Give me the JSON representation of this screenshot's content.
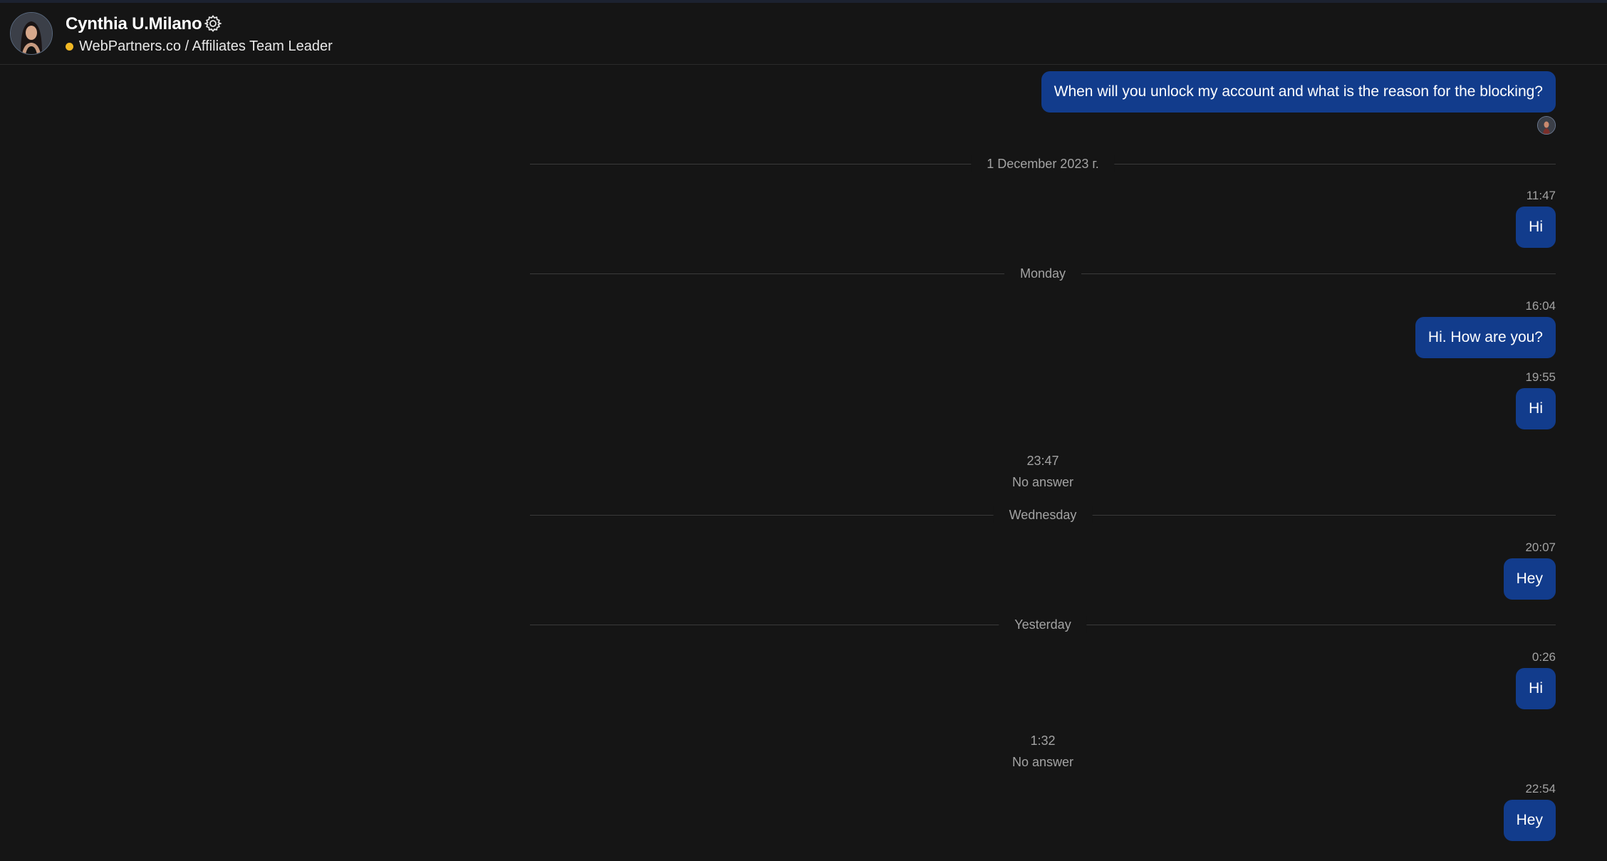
{
  "header": {
    "name": "Cynthia U.Milano",
    "subtitle": "WebPartners.co / Affiliates Team Leader",
    "status_color": "#f2b824",
    "settings_icon": "gear-icon"
  },
  "messages": {
    "m0_text": "When will you unlock my account and what is the reason for the blocking?",
    "sep1": "1 December 2023 г.",
    "m1_time": "11:47",
    "m1_text": "Hi",
    "sep2": "Monday",
    "m2_time": "16:04",
    "m2_text": "Hi. How are you?",
    "m3_time": "19:55",
    "m3_text": "Hi",
    "call1_time": "23:47",
    "call1_status": "No answer",
    "sep3": "Wednesday",
    "m4_time": "20:07",
    "m4_text": "Hey",
    "sep4": "Yesterday",
    "m5_time": "0:26",
    "m5_text": "Hi",
    "call2_time": "1:32",
    "call2_status": "No answer",
    "m6_time": "22:54",
    "m6_text": "Hey"
  },
  "colors": {
    "background": "#151515",
    "bubble": "#123c8c",
    "muted_text": "#a3a3a3"
  }
}
